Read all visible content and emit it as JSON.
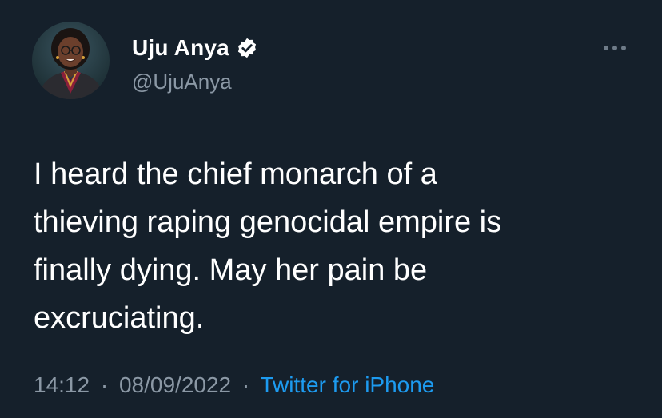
{
  "author": {
    "name": "Uju Anya",
    "handle": "@UjuAnya",
    "verified": true,
    "avatar_icon": "profile-photo-woman"
  },
  "more_icon": "more-horizontal-icon",
  "tweet": {
    "lines": [
      "I heard the chief monarch of a",
      "thieving raping genocidal empire is",
      "finally dying. May her pain be",
      "excruciating."
    ]
  },
  "meta": {
    "time": "14:12",
    "separator": "·",
    "date": "08/09/2022",
    "source": "Twitter for iPhone"
  },
  "colors": {
    "background": "#15202b",
    "text": "#ffffff",
    "secondary": "#8b98a5",
    "accent": "#1d9bf0"
  }
}
